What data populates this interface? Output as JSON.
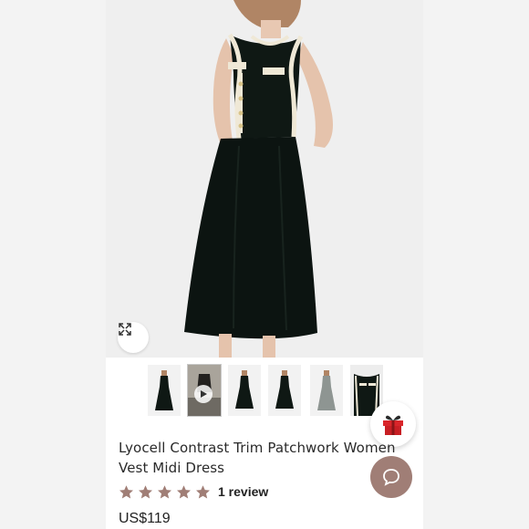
{
  "product": {
    "title": "Lyocell Contrast Trim Patchwork Women Vest Midi Dress",
    "rating": 5,
    "rating_max": 5,
    "review_count_label": "1 review",
    "price": "US$119"
  },
  "gallery": {
    "thumbnails": [
      {
        "kind": "dress-black-front",
        "active": false
      },
      {
        "kind": "video",
        "active": true
      },
      {
        "kind": "dress-black-front",
        "active": false
      },
      {
        "kind": "dress-black-front",
        "active": false
      },
      {
        "kind": "dress-grey-front",
        "active": false
      },
      {
        "kind": "dress-black-closeup",
        "active": false
      }
    ]
  },
  "icons": {
    "expand": "expand-arrows-icon",
    "gift": "gift-box-icon",
    "chat": "chat-bubble-icon",
    "play": "play-icon",
    "star": "star-icon"
  },
  "colors": {
    "star": "#a07e76",
    "chat_button": "#a07e76",
    "gift_red": "#d9252a",
    "dress_black": "#0f1814",
    "trim_cream": "#efe8d6"
  }
}
